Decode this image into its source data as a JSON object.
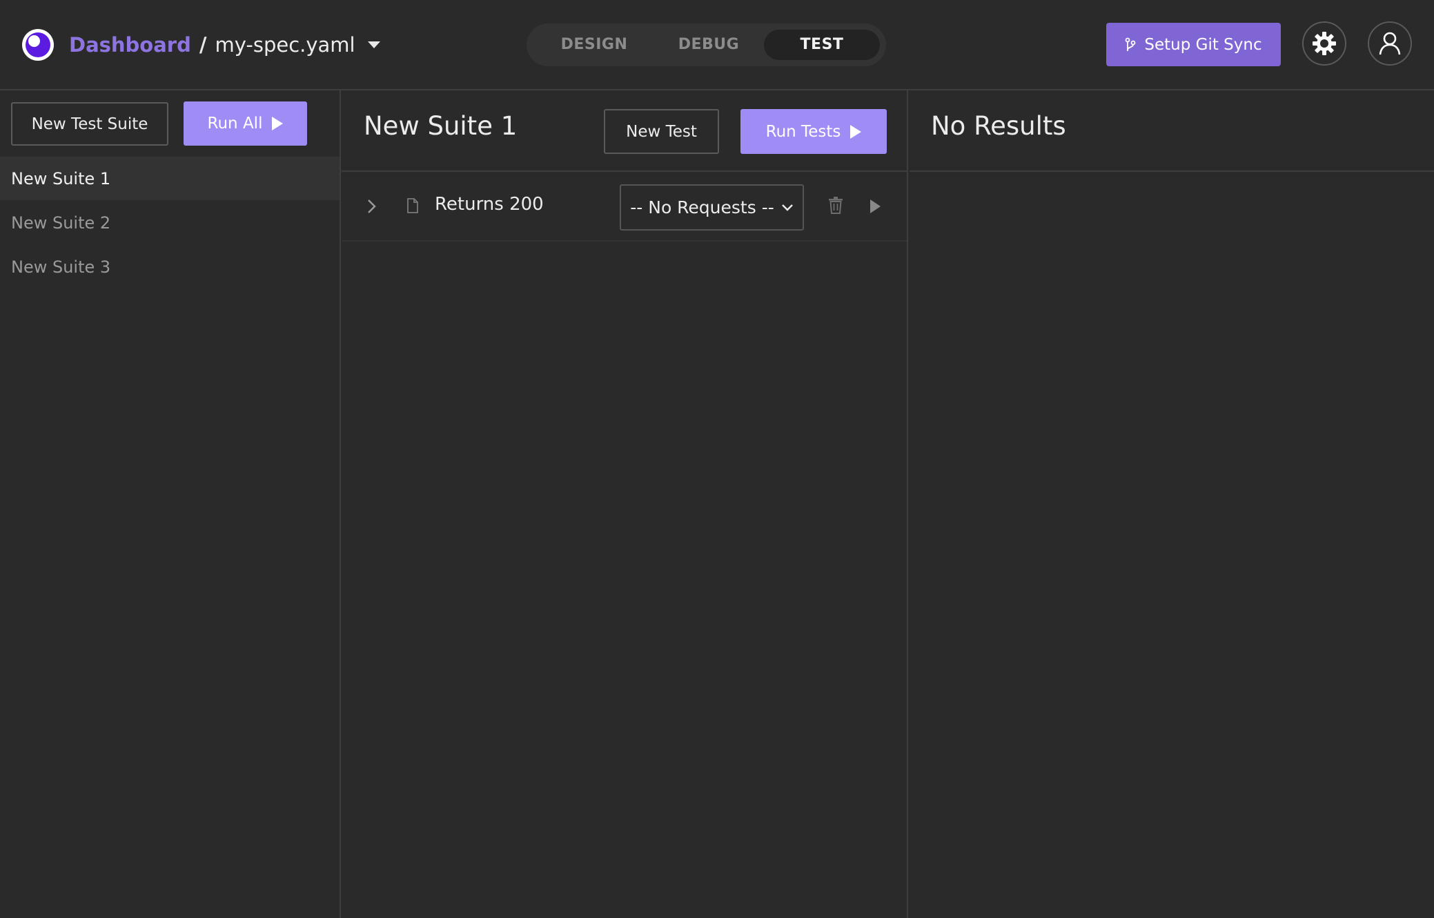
{
  "header": {
    "breadcrumb": {
      "dashboard": "Dashboard",
      "separator": "/",
      "file": "my-spec.yaml"
    },
    "tabs": [
      {
        "label": "DESIGN",
        "active": false
      },
      {
        "label": "DEBUG",
        "active": false
      },
      {
        "label": "TEST",
        "active": true
      }
    ],
    "git_sync_label": "Setup Git Sync",
    "icons": {
      "logo": "insomnia-logo-icon",
      "git": "git-branch-icon",
      "settings": "gear-icon",
      "account": "user-icon"
    }
  },
  "sidebar": {
    "new_suite_label": "New Test Suite",
    "run_all_label": "Run All",
    "suites": [
      {
        "label": "New Suite 1",
        "active": true
      },
      {
        "label": "New Suite 2",
        "active": false
      },
      {
        "label": "New Suite 3",
        "active": false
      }
    ]
  },
  "suite": {
    "title": "New Suite 1",
    "new_test_label": "New Test",
    "run_tests_label": "Run Tests",
    "tests": [
      {
        "name": "Returns 200",
        "request_select": "-- No Requests --",
        "icons": [
          "chevron-right-icon",
          "file-icon",
          "trash-icon",
          "play-icon"
        ]
      }
    ]
  },
  "results": {
    "title": "No Results"
  },
  "colors": {
    "background": "#2a2a2a",
    "accent": "#8065d5",
    "primary_button": "#a08cf5",
    "dashboard_link": "#8e74e0",
    "border": "#3e3e3e"
  }
}
